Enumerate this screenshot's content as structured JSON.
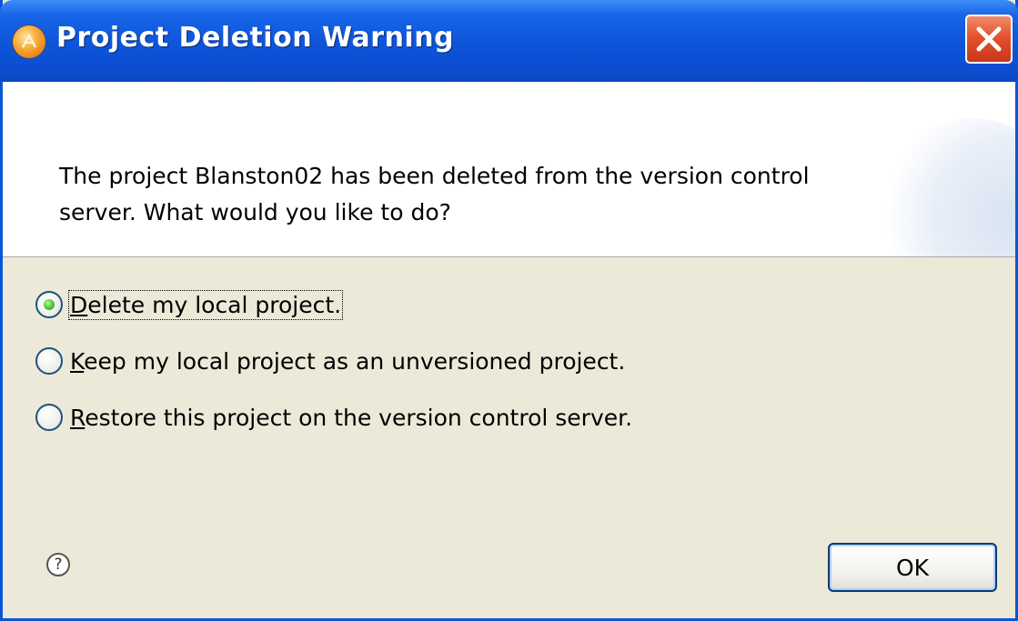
{
  "window": {
    "title": "Project Deletion Warning"
  },
  "message": {
    "line1": "The project Blanston02 has been deleted from the version control",
    "line2": "server.  What would you like to do?"
  },
  "options": [
    {
      "first": "D",
      "rest": "elete my local project.",
      "checked": true
    },
    {
      "first": "K",
      "rest": "eep my local project as an unversioned project.",
      "checked": false
    },
    {
      "first": "R",
      "rest": "estore this project on the version control server.",
      "checked": false
    }
  ],
  "help": {
    "glyph": "?"
  },
  "buttons": {
    "ok": "OK"
  },
  "colors": {
    "titlebar": "#0f56db",
    "dialog_bg": "#ece9d8",
    "close": "#e2522d"
  },
  "icons": [
    "app-icon",
    "close-icon",
    "help-icon",
    "radio-icon"
  ]
}
